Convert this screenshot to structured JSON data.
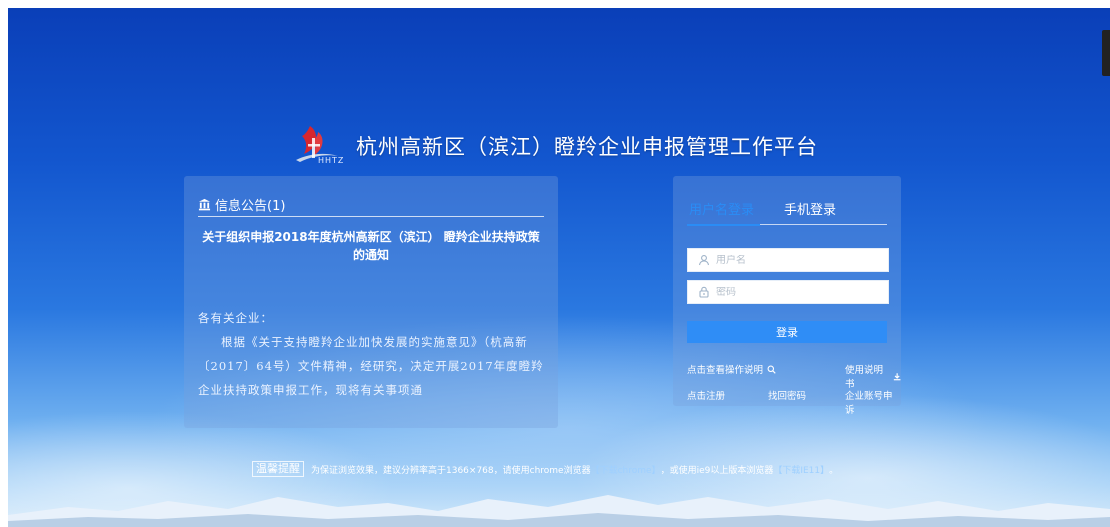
{
  "header": {
    "logo_text": "HHTZ",
    "title": "杭州高新区（滨江）瞪羚企业申报管理工作平台"
  },
  "notice": {
    "heading": "信息公告(1)",
    "title": "关于组织申报2018年度杭州高新区（滨江） 瞪羚企业扶持政策的通知",
    "salutation": "各有关企业：",
    "body": "根据《关于支持瞪羚企业加快发展的实施意见》（杭高新〔2017〕64号）文件精神，经研究，决定开展2017年度瞪羚企业扶持政策申报工作，现将有关事项通"
  },
  "login": {
    "tab_username": "用户名登录",
    "tab_phone": "手机登录",
    "username_placeholder": "用户名",
    "password_placeholder": "密码",
    "submit": "登录",
    "view_guide": "点击查看操作说明",
    "manual": "使用说明书",
    "register": "点击注册",
    "forgot": "找回密码",
    "appeal": "企业账号申诉"
  },
  "footer": {
    "tip_label": "温馨提醒",
    "text1": "为保证浏览效果，建议分辨率高于1366×768，请使用chrome浏览器",
    "download_chrome": "【下载chrome】",
    "text2": "，或使用ie9以上版本浏览器",
    "download_ie": "【下载IE11】",
    "text3": "。"
  },
  "colors": {
    "accent": "#2f8df6",
    "active_tab": "#2a8cf5",
    "background_top": "#0a3fb8"
  },
  "icons": {
    "bank": "bank-icon",
    "user": "user-icon",
    "lock": "lock-icon",
    "search": "search-zoom-icon",
    "download": "download-icon"
  }
}
